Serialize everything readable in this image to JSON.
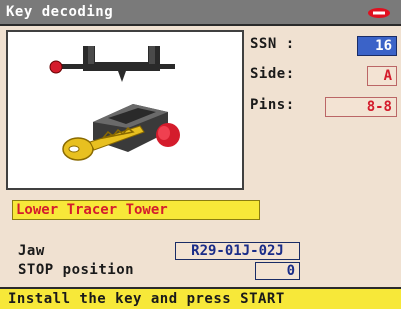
{
  "window": {
    "title": "Key decoding",
    "brand_icon": "silca-logo-icon"
  },
  "fields": {
    "ssn_label": "SSN :",
    "ssn_value": "16",
    "side_label": "Side:",
    "side_value": "A",
    "pins_label": "Pins:",
    "pins_value": "8-8"
  },
  "tracer": {
    "value": "Lower Tracer Tower"
  },
  "jaw": {
    "label": "Jaw",
    "value": "R29-01J-02J"
  },
  "stop": {
    "label": "STOP position",
    "value": "0"
  },
  "status": {
    "message": "Install the key and press START"
  },
  "colors": {
    "title_bg": "#7a7a7a",
    "screen_bg": "#f0e1d1",
    "accent_blue": "#3b63c8",
    "value_red": "#d41c2c",
    "highlight_yellow": "#f7e839"
  }
}
